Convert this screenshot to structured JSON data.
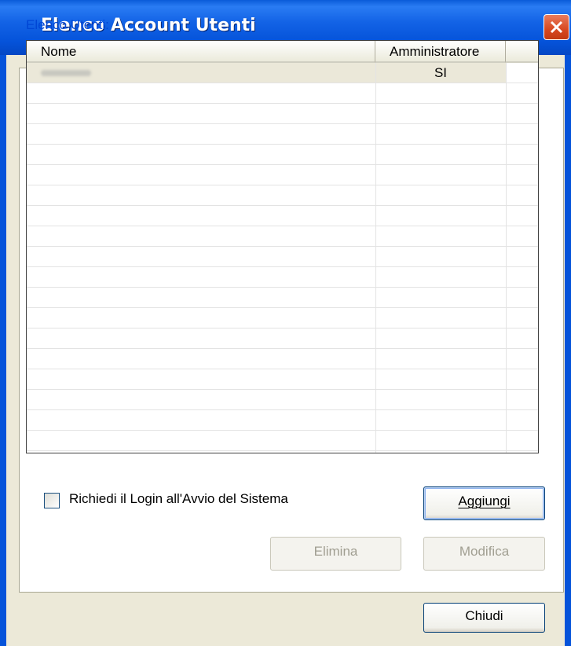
{
  "window": {
    "title": "Elenco Account Utenti"
  },
  "group": {
    "label": "Elenco Utenti:"
  },
  "table": {
    "columns": [
      "Nome",
      "Amministratore",
      ""
    ],
    "rows": [
      {
        "name_blurred": true,
        "admin": "SI"
      }
    ],
    "empty_rows": 16
  },
  "login_checkbox": {
    "label": "Richiedi il Login all'Avvio del Sistema",
    "checked": false
  },
  "buttons": {
    "aggiungi": "Aggiungi",
    "elimina": "Elimina",
    "modifica": "Modifica",
    "chiudi": "Chiudi"
  },
  "icons": {
    "close": "close-x-icon"
  },
  "colors": {
    "titlebar": "#0553da",
    "close_button": "#d8481f",
    "selected_row": "#ebe8d9",
    "group_label": "#0046d5"
  }
}
